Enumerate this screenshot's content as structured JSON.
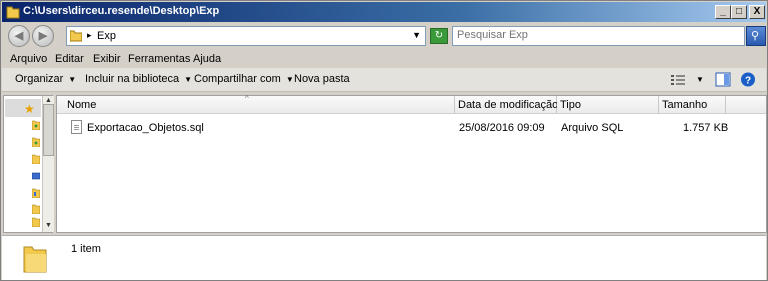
{
  "window": {
    "title": "C:\\Users\\dirceu.resende\\Desktop\\Exp",
    "min_label": "_",
    "max_label": "□",
    "close_label": "X"
  },
  "nav": {
    "back_glyph": "◀",
    "forward_glyph": "▶",
    "breadcrumb_sep": "▸",
    "current_folder": "Exp",
    "refresh_glyph": "↻",
    "search_placeholder": "Pesquisar Exp",
    "search_glyph": "⚲"
  },
  "menubar": {
    "items": [
      "Arquivo",
      "Editar",
      "Exibir",
      "Ferramentas",
      "Ajuda"
    ]
  },
  "commandbar": {
    "organize": "Organizar",
    "include": "Incluir na biblioteca",
    "share": "Compartilhar com",
    "new_folder": "Nova pasta",
    "dropdown_glyph": "▼",
    "help_glyph": "?"
  },
  "columns": {
    "name": "Nome",
    "date": "Data de modificação",
    "type": "Tipo",
    "size": "Tamanho",
    "sort_glyph": "^"
  },
  "files": [
    {
      "name": "Exportacao_Objetos.sql",
      "date": "25/08/2016 09:09",
      "type": "Arquivo SQL",
      "size": "1.757 KB"
    }
  ],
  "details": {
    "count": "1 item"
  },
  "colors": {
    "title_gradient_start": "#0a246a",
    "folder_yellow": "#f2c94c",
    "help_blue": "#1a5fc8"
  }
}
